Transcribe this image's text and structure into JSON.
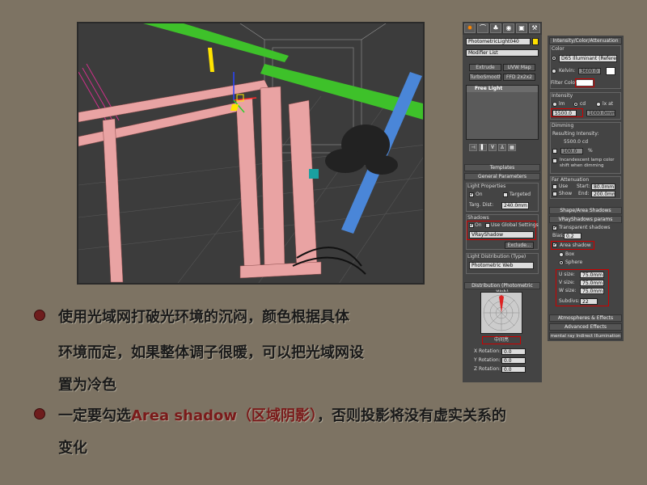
{
  "toolbar": {
    "icons": [
      "sun-icon",
      "curve-icon",
      "hierarchy-icon",
      "motion-icon",
      "display-icon",
      "hammer-icon"
    ]
  },
  "modify": {
    "object_name": "PhotometricLight040",
    "modifier_list": "Modifier List",
    "buttons": [
      "Extrude",
      "UVW Map",
      "TurboSmooth",
      "FFD 2x2x2"
    ],
    "stack_item": "Free Light"
  },
  "templates": {
    "title": "Templates"
  },
  "general": {
    "title": "General Parameters",
    "light_properties": "Light Properties",
    "on": "On",
    "targeted": "Targeted",
    "targ_dist_label": "Targ. Dist:",
    "targ_dist_value": "240.0mm",
    "shadows": "Shadows",
    "shadow_on": "On",
    "use_global": "Use Global Settings",
    "shadow_type": "VRayShadow",
    "exclude": "Exclude...",
    "light_distribution": "Light Distribution (Type)",
    "distribution_value": "Photometric Web"
  },
  "distribution": {
    "title": "Distribution (Photometric Web)",
    "web_file": "中间亮",
    "x_rot_label": "X Rotation:",
    "x_rot": "0.0",
    "y_rot_label": "Y Rotation:",
    "y_rot": "0.0",
    "z_rot_label": "Z Rotation:",
    "z_rot": "0.0"
  },
  "intensity": {
    "title": "Intensity/Color/Attenuation",
    "color": "Color",
    "preset": "D65 Illuminant (Refere",
    "kelvin_label": "Kelvin:",
    "kelvin_value": "3600.0",
    "filter_color": "Filter Color:",
    "intensity_label": "Intensity",
    "lm": "lm",
    "cd": "cd",
    "lxat": "lx at",
    "value": "5500.0",
    "distance": "1000.0mm",
    "dimming": "Dimming",
    "resulting": "Resulting Intensity:",
    "resulting_value": "5500.0 cd",
    "dim_percent": "100.0",
    "percent_sign": "%",
    "incandescent": "Incandescent lamp color shift when dimming",
    "far_atten": "Far Attenuation",
    "use": "Use",
    "show": "Show",
    "start_label": "Start:",
    "start": "80.0mm",
    "end_label": "End:",
    "end": "200.0mm"
  },
  "shape": {
    "title": "Shape/Area Shadows"
  },
  "vray": {
    "title": "VRayShadows params",
    "transparent": "Transparent shadows",
    "bias_label": "Bias:",
    "bias": "0.2",
    "area_shadow": "Area shadow",
    "box": "Box",
    "sphere": "Sphere",
    "u_label": "U size:",
    "u": "75.0mm",
    "v_label": "V size:",
    "v": "75.0mm",
    "w_label": "W size:",
    "w": "75.0mm",
    "subdivs_label": "Subdivs:",
    "subdivs": "22"
  },
  "atmos": {
    "title": "Atmospheres & Effects"
  },
  "advanced": {
    "title": "Advanced Effects"
  },
  "mental": {
    "title": "mental ray Indirect Illumination"
  },
  "notes": {
    "line1": "使用光域网打破光环境的沉闷，颜色根据具体",
    "line2": "环境而定，如果整体调子很暖，可以把光域网设",
    "line3": "置为冷色",
    "line4_pre": "一定要勾选",
    "line4_em": "Area shadow（区域阴影）",
    "line4_post": "，否则投影将没有虚实关系的",
    "line5": "变化"
  },
  "colors": {
    "background": "#7d7363",
    "bullet": "#6e1d1d",
    "highlight": "#7a1a1a"
  }
}
